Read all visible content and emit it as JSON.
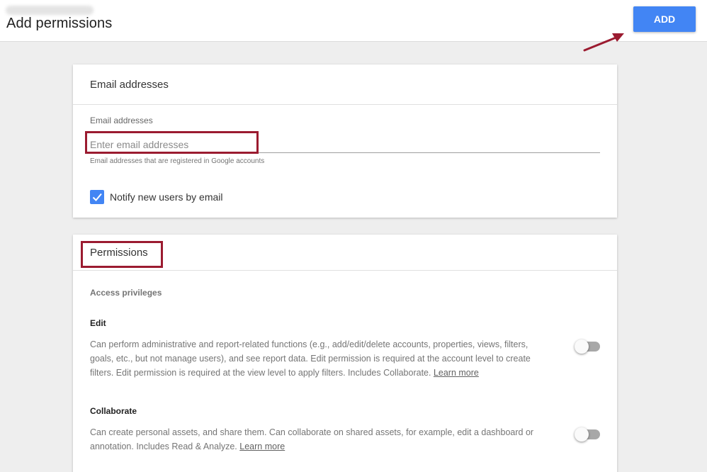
{
  "header": {
    "title": "Add permissions",
    "add_label": "ADD"
  },
  "email_card": {
    "title": "Email addresses",
    "field_label": "Email addresses",
    "input_value": "",
    "input_placeholder": "Enter email addresses",
    "helper_text": "Email addresses that are registered in Google accounts",
    "notify_label": "Notify new users by email",
    "notify_checked": true
  },
  "permissions_card": {
    "title": "Permissions",
    "section_label": "Access privileges",
    "items": [
      {
        "title": "Edit",
        "description": "Can perform administrative and report-related functions (e.g., add/edit/delete accounts, properties, views, filters, goals, etc., but not manage users), and see report data. Edit permission is required at the account level to create filters. Edit permission is required at the view level to apply filters. Includes Collaborate. ",
        "link": "Learn more",
        "enabled": false
      },
      {
        "title": "Collaborate",
        "description": "Can create personal assets, and share them. Can collaborate on shared assets, for example, edit a dashboard or annotation. Includes Read & Analyze. ",
        "link": "Learn more",
        "enabled": false
      }
    ]
  },
  "colors": {
    "accent": "#4285f4",
    "annotation": "#9b1b30"
  },
  "icons": {
    "checkbox": "check-icon",
    "arrow": "arrow-annotation-icon"
  }
}
